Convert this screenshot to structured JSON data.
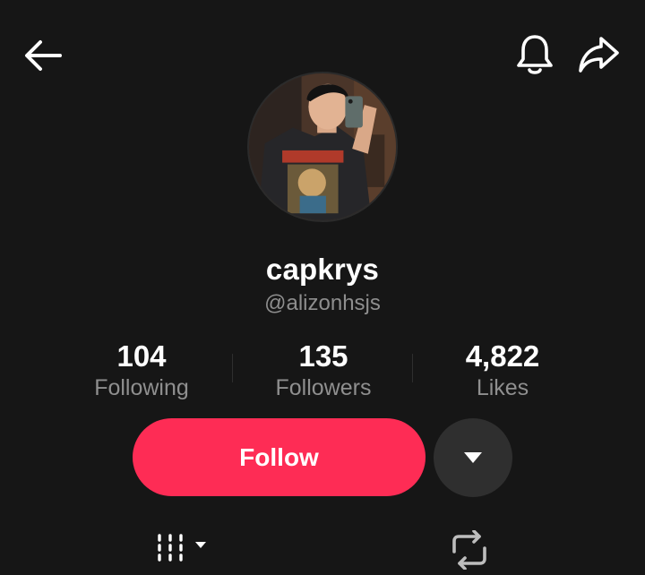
{
  "header": {
    "back_icon": "arrow-left-icon",
    "notifications_icon": "bell-icon",
    "share_icon": "share-arrow-icon"
  },
  "profile": {
    "avatar_alt": "profile photo",
    "display_name": "capkrys",
    "handle": "@alizonhsjs"
  },
  "stats": [
    {
      "value": "104",
      "label": "Following"
    },
    {
      "value": "135",
      "label": "Followers"
    },
    {
      "value": "4,822",
      "label": "Likes"
    }
  ],
  "actions": {
    "follow_label": "Follow",
    "more_icon": "caret-down-icon"
  },
  "tabs": [
    {
      "icon": "videos-grid-icon",
      "has_dropdown": true
    },
    {
      "icon": "repost-icon",
      "has_dropdown": false
    }
  ],
  "colors": {
    "background": "#161616",
    "accent": "#fe2c55",
    "secondary_text": "#8e8e8e",
    "button_dark": "#2f2f2f"
  }
}
